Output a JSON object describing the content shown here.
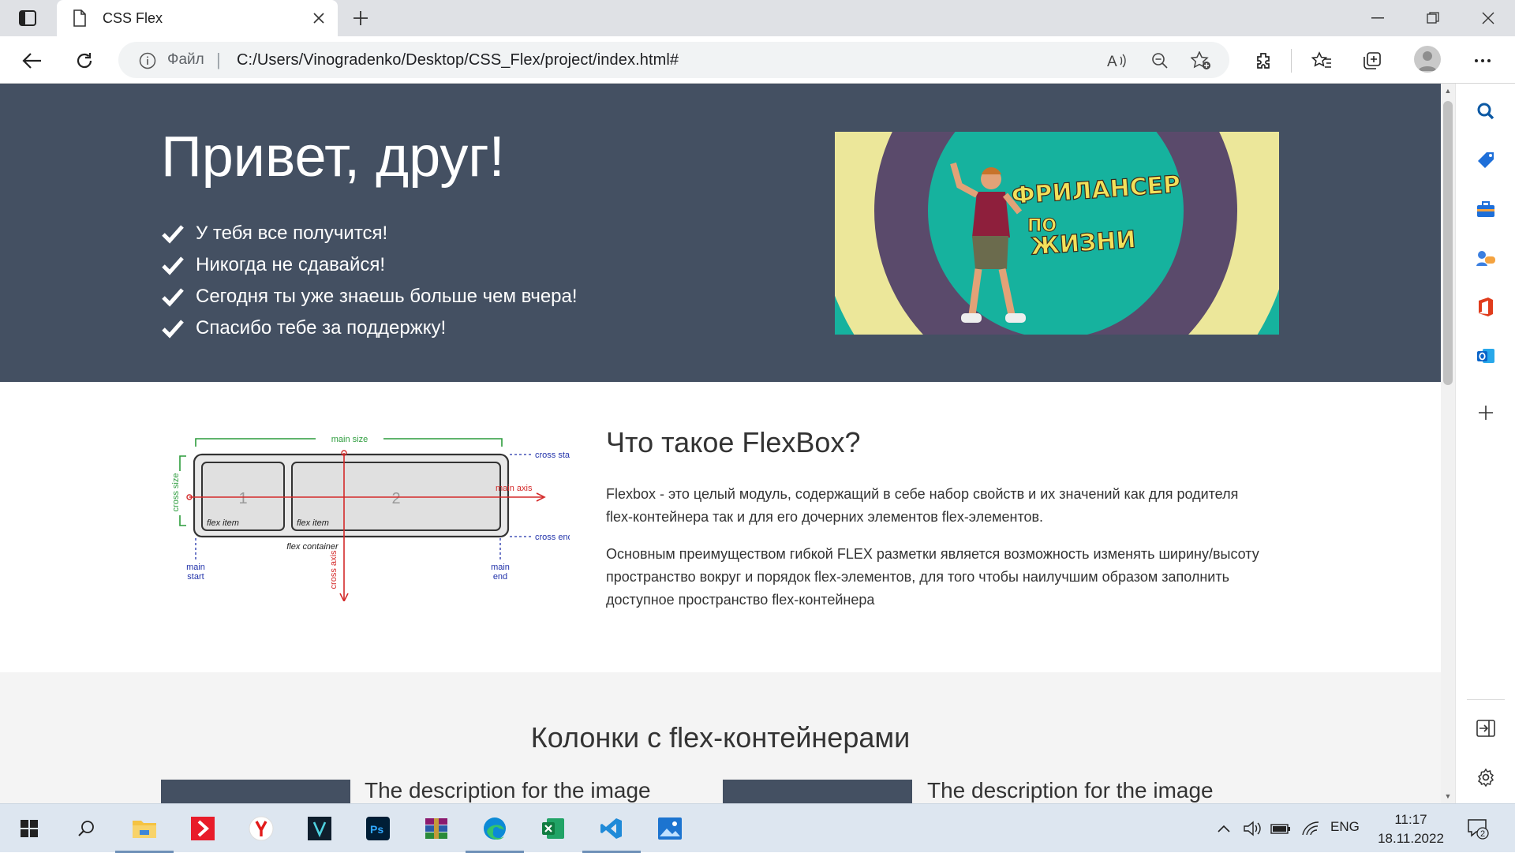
{
  "browser": {
    "tab_title": "CSS Flex",
    "address_scheme": "Файл",
    "address_separator": "|",
    "url": "C:/Users/Vinogradenko/Desktop/CSS_Flex/project/index.html#"
  },
  "hero": {
    "title": "Привет, друг!",
    "items": [
      "У тебя все получится!",
      "Никогда не сдавайся!",
      "Сегодня ты уже знаешь больше чем вчера!",
      "Спасибо тебе за поддержку!"
    ],
    "promo_text": "ФРИЛАНСЕР ПО ЖИЗНИ"
  },
  "flexbox": {
    "title": "Что такое FlexBox?",
    "paragraph1": "Flexbox - это целый модуль, содержащий в себе набор свойств и их значений как для родителя flex-контейнера так и для его дочерних элементов flex-элементов.",
    "paragraph2": "Основным преимуществом гибкой FLEX разметки является возможность изменять ширину/высоту пространство вокруг и порядок flex-элементов, для того чтобы наилучшим образом заполнить доступное пространство flex-контейнера",
    "diagram": {
      "main_size": "main size",
      "cross_start": "cross start",
      "main_axis": "main axis",
      "cross_end": "cross end",
      "cross_size": "cross size",
      "cross_axis": "cross axis",
      "item1_num": "1",
      "item2_num": "2",
      "flex_item": "flex item",
      "flex_container": "flex container",
      "main_start_1": "main",
      "main_start_2": "start",
      "main_end_1": "main",
      "main_end_2": "end"
    }
  },
  "columns": {
    "title": "Колонки с flex-контейнерами",
    "cards": [
      {
        "description": "The description for the image"
      },
      {
        "description": "The description for the image"
      }
    ]
  },
  "taskbar": {
    "language": "ENG",
    "time": "11:17",
    "date": "18.11.2022",
    "notification_count": "2"
  },
  "colors": {
    "hero_bg": "#445062",
    "accent_edge": "#0c59a4",
    "promo_teal": "#16b29e",
    "promo_purple": "#5a4a6b",
    "promo_yellow": "#ece79a"
  }
}
